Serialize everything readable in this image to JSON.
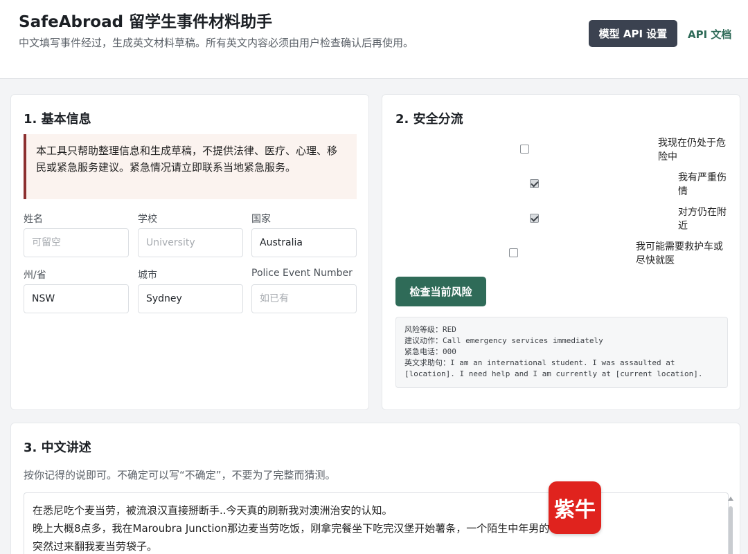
{
  "header": {
    "title": "SafeAbroad 留学生事件材料助手",
    "subtitle": "中文填写事件经过，生成英文材料草稿。所有英文内容必须由用户检查确认后再使用。",
    "model_button": "模型 API 设置",
    "api_docs_link": "API 文档"
  },
  "basic_info": {
    "title": "1. 基本信息",
    "notice": "本工具只帮助整理信息和生成草稿，不提供法律、医疗、心理、移民或紧急服务建议。紧急情况请立即联系当地紧急服务。",
    "fields": {
      "name": {
        "label": "姓名",
        "value": "",
        "placeholder": "可留空"
      },
      "school": {
        "label": "学校",
        "value": "",
        "placeholder": "University"
      },
      "country": {
        "label": "国家",
        "value": "Australia",
        "placeholder": ""
      },
      "state": {
        "label": "州/省",
        "value": "NSW",
        "placeholder": ""
      },
      "city": {
        "label": "城市",
        "value": "Sydney",
        "placeholder": ""
      },
      "police_event_number": {
        "label": "Police Event Number",
        "value": "",
        "placeholder": "如已有"
      }
    }
  },
  "triage": {
    "title": "2. 安全分流",
    "items": [
      {
        "label": "我现在仍处于危险中",
        "checked": false
      },
      {
        "label": "我有严重伤情",
        "checked": true
      },
      {
        "label": "对方仍在附近",
        "checked": true
      },
      {
        "label": "我可能需要救护车或尽快就医",
        "checked": false
      }
    ],
    "check_button": "检查当前风险",
    "result": {
      "line1": "风险等级：RED",
      "line2": "建议动作：Call emergency services immediately",
      "line3": "紧急电话：000",
      "line4": "英文求助句：I am an international student. I was assaulted at",
      "line5": "[location]. I need help and I am currently at [current location]."
    }
  },
  "narrative": {
    "title": "3. 中文讲述",
    "hint": "按你记得的说即可。不确定可以写“不确定”，不要为了完整而猜测。",
    "line1": "在悉尼吃个麦当劳，被流浪汉直接掰断手..今天真的刷新我对澳洲治安的认知。",
    "line2": "晚上大概8点多，我在Maroubra Junction那边麦当劳吃饭，刚拿完餐坐下吃完汉堡开始薯条，一个陌生中年男的",
    "line3": "突然过来翻我麦当劳袋子。"
  },
  "watermark": {
    "text": "紫牛"
  },
  "colors": {
    "accent_green": "#2f6b58",
    "dark_button": "#3b4250",
    "warning_border": "#8c2f2f",
    "watermark_red": "#e0231e"
  }
}
